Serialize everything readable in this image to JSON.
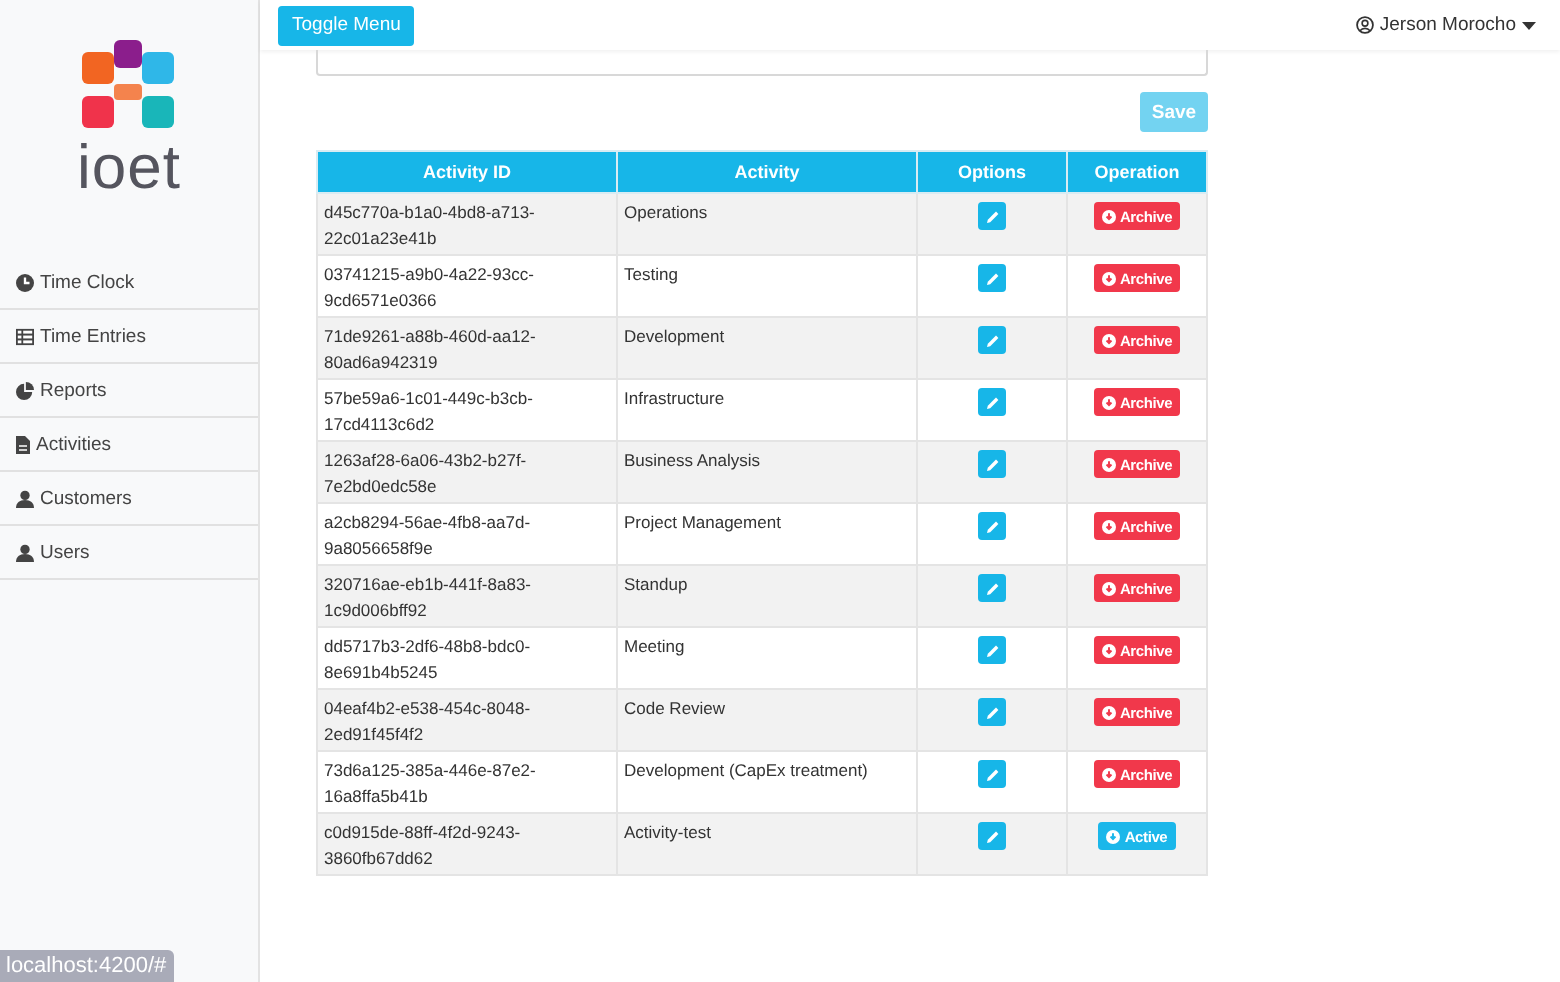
{
  "logo": {
    "text": "ioet"
  },
  "sidebar": {
    "items": [
      {
        "label": "Time Clock",
        "kind": "clock"
      },
      {
        "label": "Time Entries",
        "kind": "list"
      },
      {
        "label": "Reports",
        "kind": "pie"
      },
      {
        "label": "Activities",
        "kind": "file"
      },
      {
        "label": "Customers",
        "kind": "user"
      },
      {
        "label": "Users",
        "kind": "user"
      }
    ]
  },
  "topbar": {
    "toggle_button": "Toggle Menu",
    "user": "Jerson Morocho"
  },
  "form": {
    "save_button": {
      "label": "Save",
      "disabled": true
    }
  },
  "table": {
    "columns": [
      "Activity ID",
      "Activity",
      "Options",
      "Operation"
    ],
    "rows": [
      {
        "id": "d45c770a-b1a0-4bd8-a713-22c01a23e41b",
        "activity": "Operations",
        "operation": {
          "kind": "archive",
          "label": "Archive"
        }
      },
      {
        "id": "03741215-a9b0-4a22-93cc-9cd6571e0366",
        "activity": "Testing",
        "operation": {
          "kind": "archive",
          "label": "Archive"
        }
      },
      {
        "id": "71de9261-a88b-460d-aa12-80ad6a942319",
        "activity": "Development",
        "operation": {
          "kind": "archive",
          "label": "Archive"
        }
      },
      {
        "id": "57be59a6-1c01-449c-b3cb-17cd4113c6d2",
        "activity": "Infrastructure",
        "operation": {
          "kind": "archive",
          "label": "Archive"
        }
      },
      {
        "id": "1263af28-6a06-43b2-b27f-7e2bd0edc58e",
        "activity": "Business Analysis",
        "operation": {
          "kind": "archive",
          "label": "Archive"
        }
      },
      {
        "id": "a2cb8294-56ae-4fb8-aa7d-9a8056658f9e",
        "activity": "Project Management",
        "operation": {
          "kind": "archive",
          "label": "Archive"
        }
      },
      {
        "id": "320716ae-eb1b-441f-8a83-1c9d006bff92",
        "activity": "Standup",
        "operation": {
          "kind": "archive",
          "label": "Archive"
        }
      },
      {
        "id": "dd5717b3-2df6-48b8-bdc0-8e691b4b5245",
        "activity": "Meeting",
        "operation": {
          "kind": "archive",
          "label": "Archive"
        }
      },
      {
        "id": "04eaf4b2-e538-454c-8048-2ed91f45f4f2",
        "activity": "Code Review",
        "operation": {
          "kind": "archive",
          "label": "Archive"
        }
      },
      {
        "id": "73d6a125-385a-446e-87e2-16a8ffa5b41b",
        "activity": "Development (CapEx treatment)",
        "operation": {
          "kind": "archive",
          "label": "Archive"
        }
      },
      {
        "id": "c0d915de-88ff-4f2d-9243-3860fb67dd62",
        "activity": "Activity-test",
        "operation": {
          "kind": "active",
          "label": "Active"
        }
      }
    ]
  },
  "status_bar": {
    "url": "localhost:4200/#"
  }
}
